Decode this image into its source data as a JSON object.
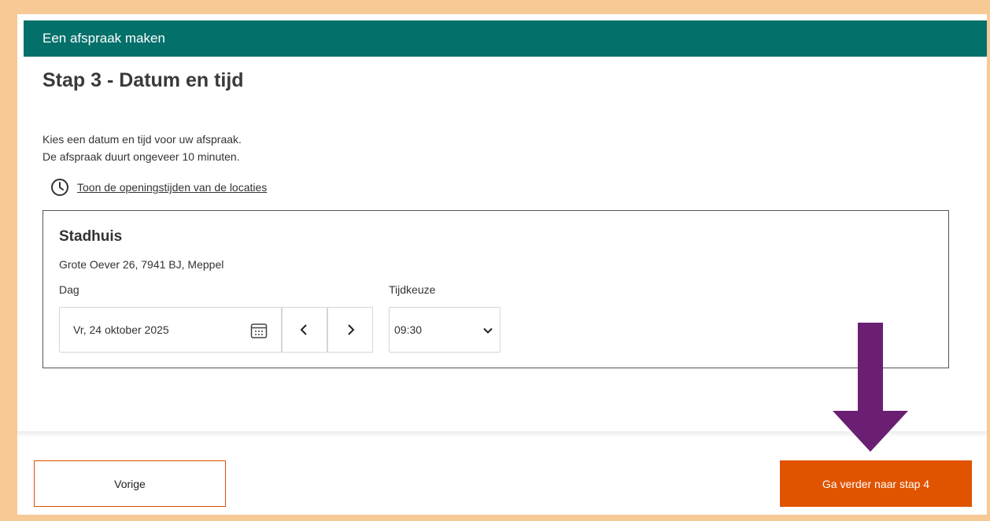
{
  "header": {
    "title": "Een afspraak maken"
  },
  "step": {
    "title": "Stap 3 - Datum en tijd"
  },
  "intro": {
    "line1": "Kies een datum en tijd voor uw afspraak.",
    "line2": "De afspraak duurt ongeveer 10 minuten."
  },
  "opening_hours": {
    "link_text": "Toon de openingstijden van de locaties",
    "icon": "clock-icon"
  },
  "location": {
    "name": "Stadhuis",
    "address": "Grote Oever 26, 7941 BJ, Meppel",
    "day_label": "Dag",
    "date_value": "Vr, 24 oktober 2025",
    "time_label": "Tijdkeuze",
    "time_value": "09:30"
  },
  "footer": {
    "prev_label": "Vorige",
    "next_label": "Ga verder naar stap 4"
  },
  "colors": {
    "header_bg": "#04706a",
    "primary_button": "#e05400",
    "outline_button_border": "#e04e00",
    "annotation_arrow": "#6a1f73",
    "frame_border": "#f6c995"
  }
}
